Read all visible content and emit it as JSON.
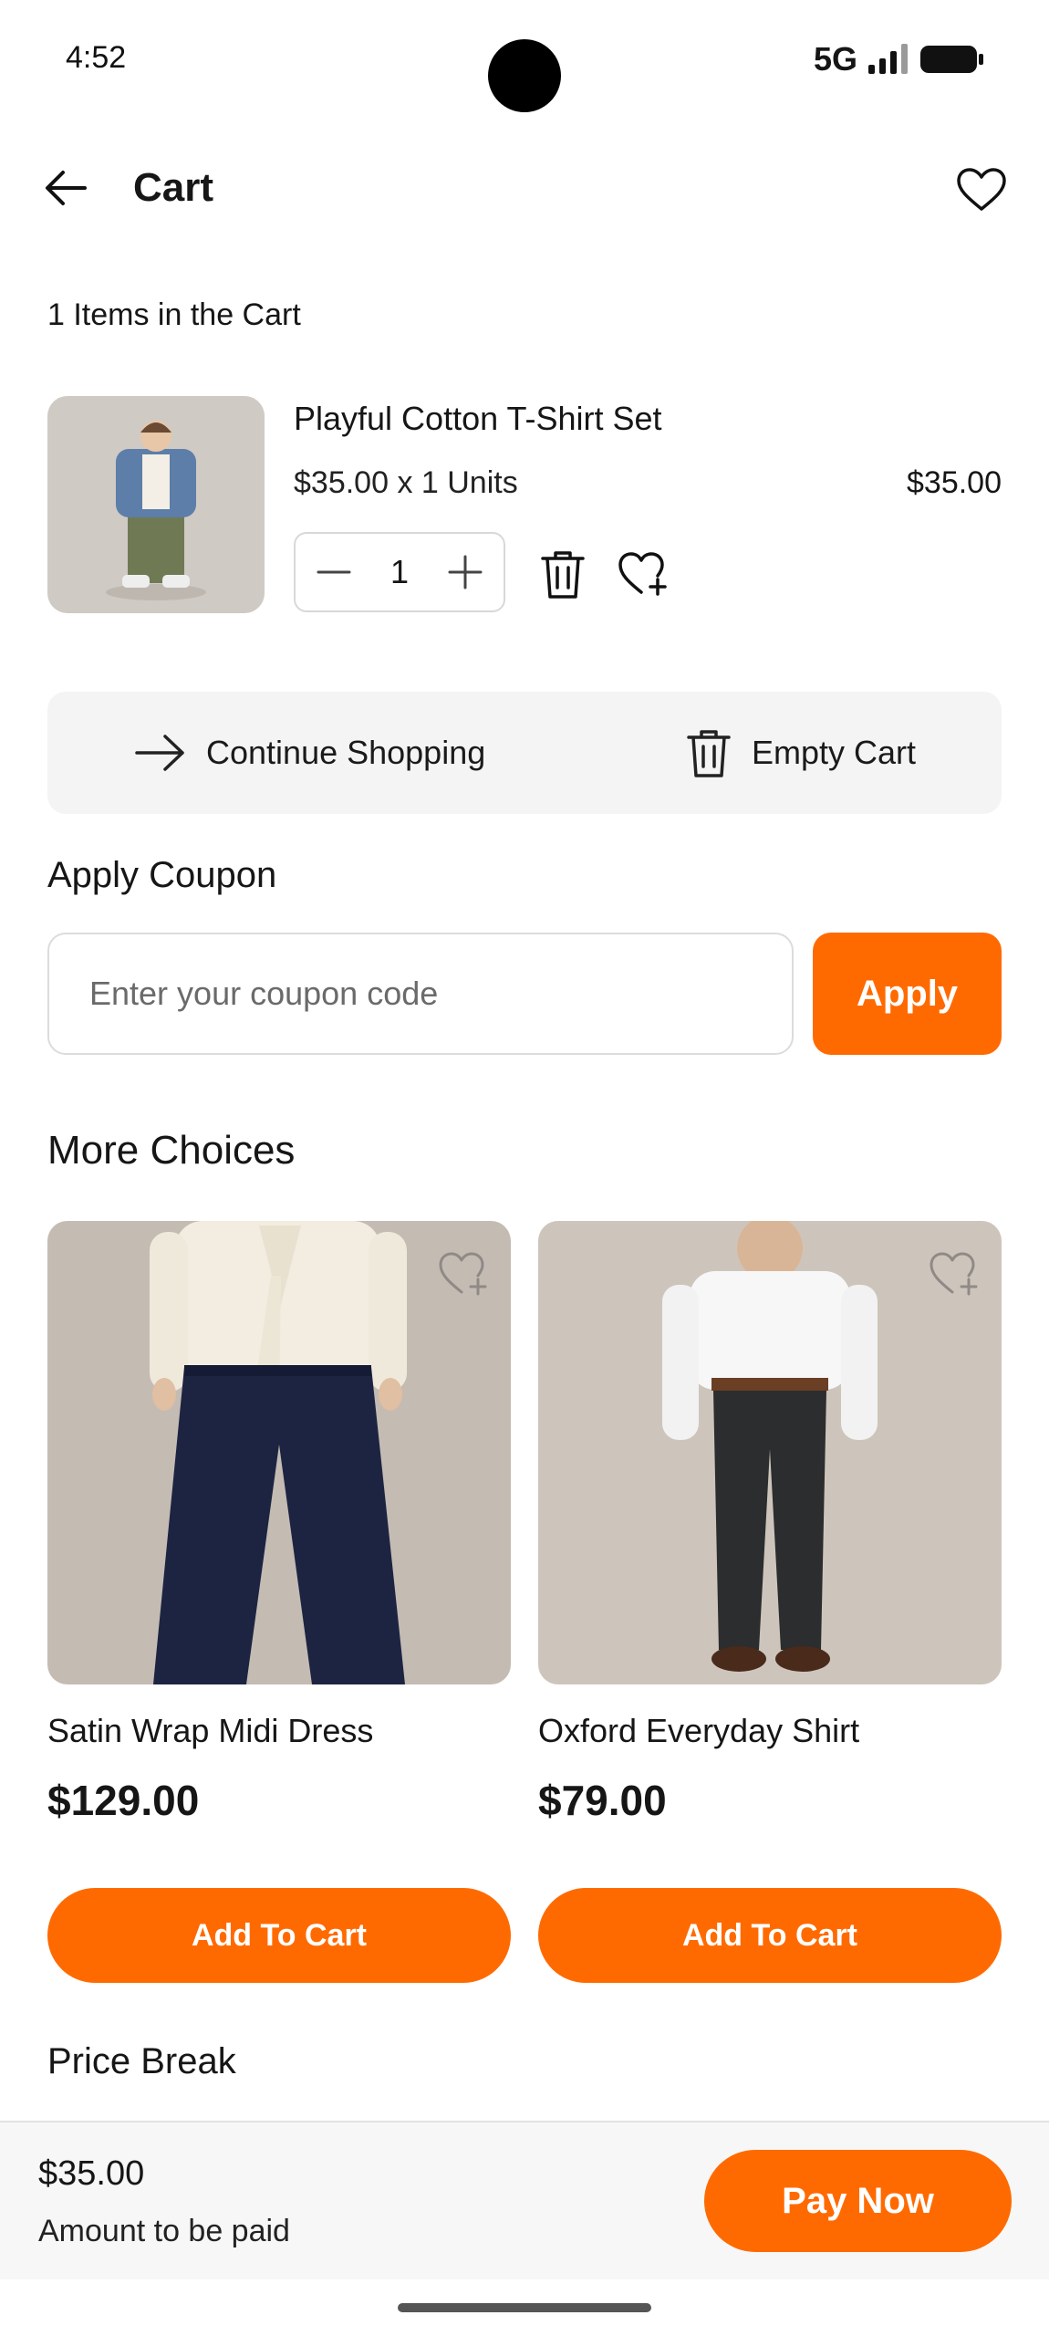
{
  "status_bar": {
    "time": "4:52",
    "network": "5G"
  },
  "header": {
    "title": "Cart"
  },
  "cart": {
    "count_text": "1 Items in the Cart",
    "items": [
      {
        "name": "Playful Cotton T-Shirt Set",
        "unit_text": "$35.00 x 1 Units",
        "total": "$35.00",
        "quantity": "1"
      }
    ]
  },
  "actions": {
    "continue_label": "Continue Shopping",
    "empty_label": "Empty Cart"
  },
  "coupon": {
    "title": "Apply Coupon",
    "placeholder": "Enter your coupon code",
    "apply_label": "Apply"
  },
  "more_choices": {
    "title": "More Choices",
    "products": [
      {
        "name": "Satin Wrap Midi Dress",
        "price": "$129.00",
        "button": "Add To Cart"
      },
      {
        "name": "Oxford Everyday Shirt",
        "price": "$79.00",
        "button": "Add To Cart"
      }
    ]
  },
  "price_break": {
    "title": "Price Break"
  },
  "footer": {
    "amount": "$35.00",
    "amount_label": "Amount to be paid",
    "pay_label": "Pay Now"
  },
  "colors": {
    "accent": "#ff6a00",
    "text": "#161616",
    "panel": "#f4f4f4"
  }
}
